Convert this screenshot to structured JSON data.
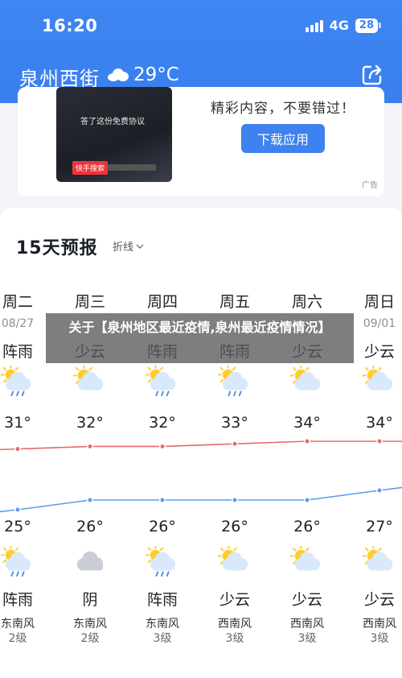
{
  "status_bar": {
    "time": "16:20",
    "network": "4G",
    "battery": "28"
  },
  "header": {
    "city": "泉州西街",
    "temperature": "29°C",
    "weather_icon": "cloudy-icon",
    "share_icon": "share-icon"
  },
  "ad": {
    "image_text": "答了这份免费协议",
    "image_brand": "快手搜索",
    "headline": "精彩内容，不要错过！",
    "cta": "下载应用",
    "tag": "广告"
  },
  "forecast": {
    "title": "15天预报",
    "mode": "折线",
    "days": [
      {
        "name": "周二",
        "date": "08/27",
        "day_cond": "阵雨",
        "day_icon": "rain-shower-icon",
        "high": "31°",
        "low": "25°",
        "night_icon": "rain-shower-icon",
        "night_cond": "阵雨",
        "wind": "东南风",
        "level": "2级"
      },
      {
        "name": "周三",
        "date": "",
        "day_cond": "少云",
        "day_icon": "partly-cloudy-icon",
        "high": "32°",
        "low": "26°",
        "night_icon": "cloudy-icon",
        "night_cond": "阴",
        "wind": "东南风",
        "level": "2级"
      },
      {
        "name": "周四",
        "date": "",
        "day_cond": "阵雨",
        "day_icon": "rain-shower-icon",
        "high": "32°",
        "low": "26°",
        "night_icon": "rain-shower-icon",
        "night_cond": "阵雨",
        "wind": "东南风",
        "level": "3级"
      },
      {
        "name": "周五",
        "date": "",
        "day_cond": "阵雨",
        "day_icon": "rain-shower-icon",
        "high": "33°",
        "low": "26°",
        "night_icon": "partly-cloudy-icon",
        "night_cond": "少云",
        "wind": "西南风",
        "level": "3级"
      },
      {
        "name": "周六",
        "date": "",
        "day_cond": "少云",
        "day_icon": "partly-cloudy-icon",
        "high": "34°",
        "low": "26°",
        "night_icon": "partly-cloudy-icon",
        "night_cond": "少云",
        "wind": "西南风",
        "level": "3级"
      },
      {
        "name": "周日",
        "date": "09/01",
        "day_cond": "少云",
        "day_icon": "partly-cloudy-icon",
        "high": "34°",
        "low": "27°",
        "night_icon": "partly-cloudy-icon",
        "night_cond": "少云",
        "wind": "西南风",
        "level": "3级"
      }
    ]
  },
  "chart_data": {
    "type": "line",
    "categories": [
      "周二",
      "周三",
      "周四",
      "周五",
      "周六",
      "周日"
    ],
    "series": [
      {
        "values": [
          31,
          32,
          32,
          33,
          34,
          34
        ],
        "color": "#e86a6a"
      },
      {
        "values": [
          25,
          26,
          26,
          26,
          26,
          27
        ],
        "color": "#5b9bea"
      }
    ]
  },
  "caption": "关于【泉州地区最近疫情,泉州最近疫情情况】"
}
